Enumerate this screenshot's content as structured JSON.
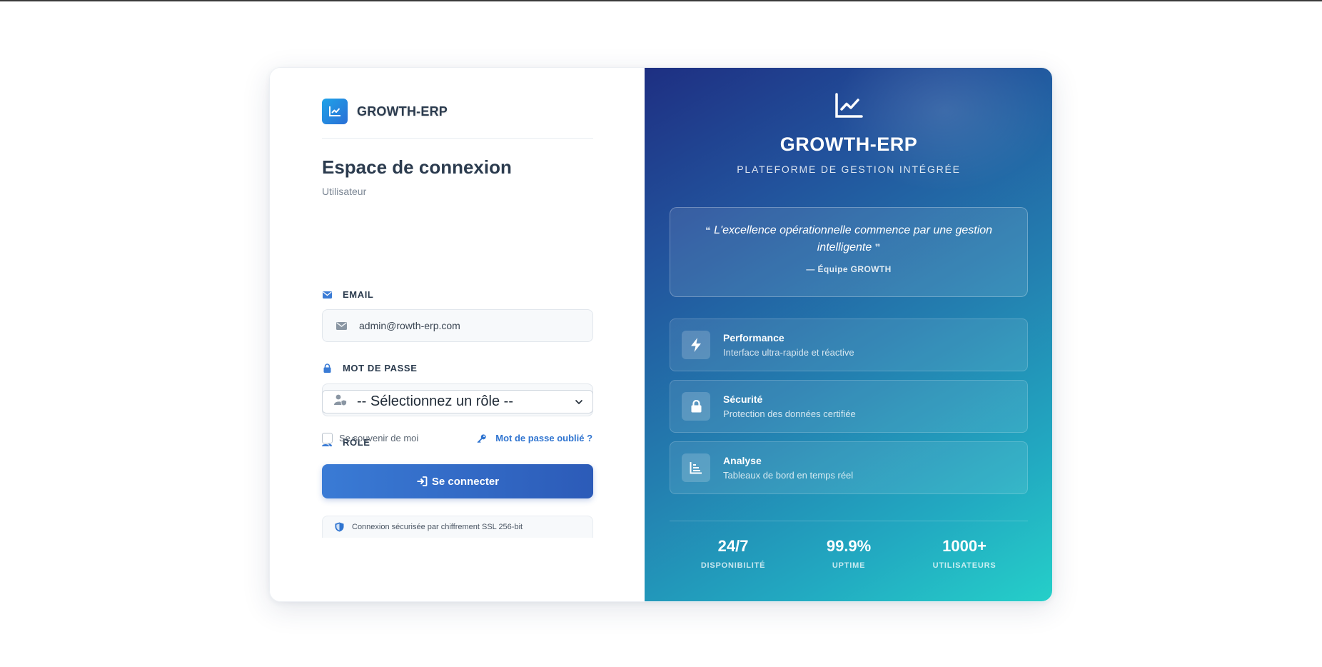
{
  "brand": {
    "name": "GROWTH-ERP"
  },
  "login": {
    "title": "Espace de connexion",
    "subtitle": "Utilisateur",
    "email_label": "EMAIL",
    "email_value": "admin@rowth-erp.com",
    "password_label": "MOT DE PASSE",
    "password_value": "••••••••",
    "role_label": "RÔLE",
    "role_selected": "-- Sélectionnez un rôle --",
    "remember_label": "Se souvenir de moi",
    "forgot_label": "Mot de passe oublié ?",
    "submit_label": "Se connecter",
    "secure_text": "Connexion sécurisée par chiffrement SSL 256-bit"
  },
  "hero": {
    "title": "GROWTH-ERP",
    "subtitle": "PLATEFORME DE GESTION INTÉGRÉE",
    "quote": "L'excellence opérationnelle commence par une gestion intelligente",
    "quote_author": "— Équipe GROWTH",
    "features": [
      {
        "title": "Performance",
        "desc": "Interface ultra-rapide et réactive",
        "icon": "bolt-icon"
      },
      {
        "title": "Sécurité",
        "desc": "Protection des données certifiée",
        "icon": "lock-icon"
      },
      {
        "title": "Analyse",
        "desc": "Tableaux de bord en temps réel",
        "icon": "bar-chart-icon"
      }
    ],
    "stats": [
      {
        "value": "24/7",
        "label": "DISPONIBILITÉ"
      },
      {
        "value": "99.9%",
        "label": "UPTIME"
      },
      {
        "value": "1000+",
        "label": "UTILISATEURS"
      }
    ]
  },
  "colors": {
    "accent": "#2f74d0",
    "button_start": "#3a7bd5",
    "button_end": "#2c5bb8",
    "text_dark": "#2b3b4e",
    "hero_start": "#1e2f82",
    "hero_end": "#25cfc9"
  }
}
